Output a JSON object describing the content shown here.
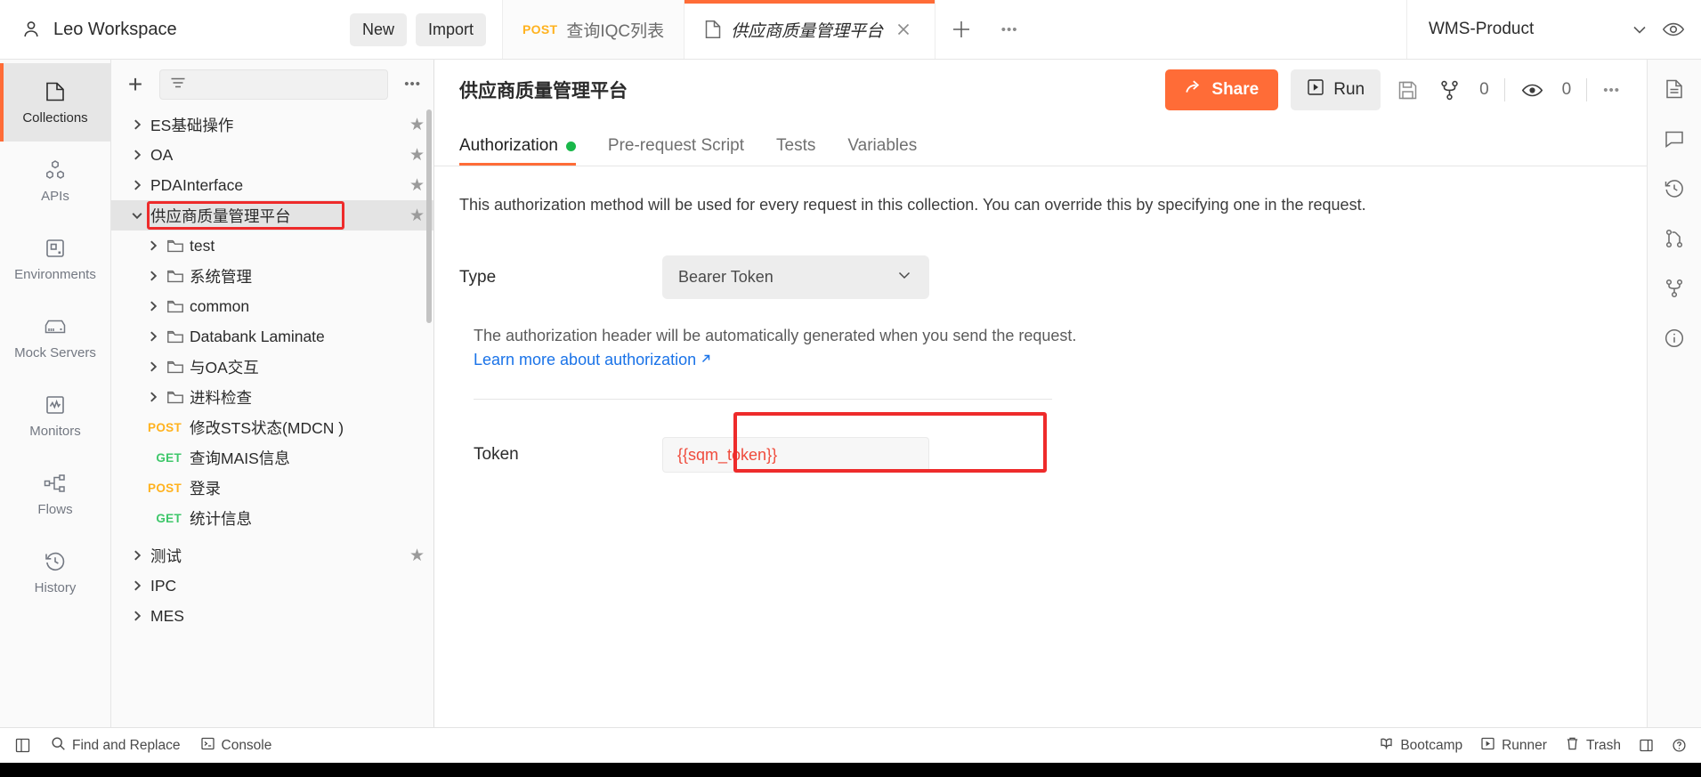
{
  "workspace": {
    "name": "Leo Workspace",
    "new_label": "New",
    "import_label": "Import"
  },
  "tabs": [
    {
      "method": "POST",
      "label": "查询IQC列表",
      "active": false,
      "type": "request"
    },
    {
      "method": "",
      "label": "供应商质量管理平台",
      "active": true,
      "type": "collection"
    }
  ],
  "environment": {
    "selected": "WMS-Product"
  },
  "rail": {
    "items": [
      {
        "label": "Collections",
        "icon": "collections-icon",
        "active": true
      },
      {
        "label": "APIs",
        "icon": "apis-icon",
        "active": false
      },
      {
        "label": "Environments",
        "icon": "environments-icon",
        "active": false
      },
      {
        "label": "Mock Servers",
        "icon": "mock-servers-icon",
        "active": false
      },
      {
        "label": "Monitors",
        "icon": "monitors-icon",
        "active": false
      },
      {
        "label": "Flows",
        "icon": "flows-icon",
        "active": false
      },
      {
        "label": "History",
        "icon": "history-icon",
        "active": false
      }
    ]
  },
  "sidebar": {
    "search_placeholder": "",
    "tree": [
      {
        "label": "ES基础操作",
        "level": 1,
        "kind": "collection",
        "expanded": false,
        "starred": true
      },
      {
        "label": "OA",
        "level": 1,
        "kind": "collection",
        "expanded": false,
        "starred": true
      },
      {
        "label": "PDAInterface",
        "level": 1,
        "kind": "collection",
        "expanded": false,
        "starred": true
      },
      {
        "label": "供应商质量管理平台",
        "level": 1,
        "kind": "collection",
        "expanded": true,
        "starred": true,
        "selected": true,
        "annotated": true
      },
      {
        "label": "test",
        "level": 2,
        "kind": "folder",
        "expanded": false
      },
      {
        "label": "系统管理",
        "level": 2,
        "kind": "folder",
        "expanded": false
      },
      {
        "label": "common",
        "level": 2,
        "kind": "folder",
        "expanded": false
      },
      {
        "label": "Databank Laminate",
        "level": 2,
        "kind": "folder",
        "expanded": false
      },
      {
        "label": "与OA交互",
        "level": 2,
        "kind": "folder",
        "expanded": false
      },
      {
        "label": "进料检查",
        "level": 2,
        "kind": "folder",
        "expanded": false
      },
      {
        "label": "修改STS状态(MDCN )",
        "level": 3,
        "kind": "request",
        "method": "POST"
      },
      {
        "label": "查询MAIS信息",
        "level": 3,
        "kind": "request",
        "method": "GET"
      },
      {
        "label": "登录",
        "level": 3,
        "kind": "request",
        "method": "POST"
      },
      {
        "label": "统计信息",
        "level": 3,
        "kind": "request",
        "method": "GET"
      },
      {
        "label": "测试",
        "level": 1,
        "kind": "collection",
        "expanded": false,
        "starred": true
      },
      {
        "label": "IPC",
        "level": 1,
        "kind": "collection",
        "expanded": false
      },
      {
        "label": "MES",
        "level": 1,
        "kind": "collection",
        "expanded": false
      }
    ]
  },
  "content": {
    "title": "供应商质量管理平台",
    "share_label": "Share",
    "run_label": "Run",
    "fork_count": "0",
    "watch_count": "0",
    "tabs": [
      {
        "label": "Authorization",
        "active": true,
        "dot": true
      },
      {
        "label": "Pre-request Script",
        "active": false,
        "dot": false
      },
      {
        "label": "Tests",
        "active": false,
        "dot": false
      },
      {
        "label": "Variables",
        "active": false,
        "dot": false
      }
    ],
    "description": "This authorization method will be used for every request in this collection. You can override this by specifying one in the request.",
    "type_label": "Type",
    "type_value": "Bearer Token",
    "note": "The authorization header will be automatically generated when you send the request.",
    "link_label": "Learn more about authorization",
    "token_label": "Token",
    "token_value": "{{sqm_token}}"
  },
  "statusbar": {
    "left": [
      {
        "label": "",
        "icon": "sidebar-toggle-icon"
      },
      {
        "label": "Find and Replace",
        "icon": "search-icon"
      },
      {
        "label": "Console",
        "icon": "console-icon"
      }
    ],
    "right": [
      {
        "label": "Bootcamp",
        "icon": "bootcamp-icon"
      },
      {
        "label": "Runner",
        "icon": "runner-icon"
      },
      {
        "label": "Trash",
        "icon": "trash-icon"
      },
      {
        "label": "",
        "icon": "panel-toggle-icon"
      },
      {
        "label": "",
        "icon": "help-icon"
      }
    ]
  },
  "colors": {
    "accent": "#ff6c37",
    "annotation": "#ee2b2b",
    "method_post": "#ffb21e",
    "method_get": "#3ec76a",
    "status_dot": "#19b84a",
    "link": "#1a73e8",
    "token_text": "#ef4b3c"
  }
}
